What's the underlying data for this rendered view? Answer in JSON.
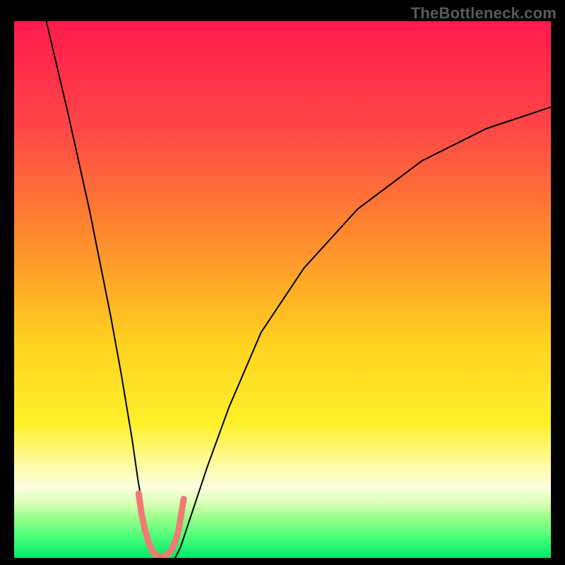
{
  "watermark": "TheBottleneck.com",
  "chart_data": {
    "type": "line",
    "title": "",
    "xlabel": "",
    "ylabel": "",
    "xlim": [
      0,
      100
    ],
    "ylim": [
      0,
      100
    ],
    "grid": false,
    "legend": null,
    "background_gradient_stops": [
      {
        "offset": 0.0,
        "color": "#ff1a4d"
      },
      {
        "offset": 0.2,
        "color": "#ff4747"
      },
      {
        "offset": 0.4,
        "color": "#ff8a2e"
      },
      {
        "offset": 0.6,
        "color": "#ffd21f"
      },
      {
        "offset": 0.75,
        "color": "#fff02a"
      },
      {
        "offset": 0.83,
        "color": "#fffca8"
      },
      {
        "offset": 0.87,
        "color": "#faffe0"
      },
      {
        "offset": 0.9,
        "color": "#d6ffb0"
      },
      {
        "offset": 0.93,
        "color": "#8fff86"
      },
      {
        "offset": 0.96,
        "color": "#4cff7a"
      },
      {
        "offset": 1.0,
        "color": "#00e66a"
      }
    ],
    "series": [
      {
        "name": "bottleneck_curve_left",
        "stroke": "#000000",
        "stroke_width": 2,
        "x": [
          6,
          10,
          14,
          18,
          20,
          22,
          23,
          24,
          25,
          26,
          27
        ],
        "y": [
          100,
          83,
          65,
          45,
          34,
          22,
          15,
          9,
          4,
          1,
          0
        ]
      },
      {
        "name": "bottleneck_curve_right",
        "stroke": "#000000",
        "stroke_width": 2,
        "x": [
          30,
          31,
          33,
          36,
          40,
          46,
          54,
          64,
          76,
          88,
          100
        ],
        "y": [
          0,
          2,
          8,
          17,
          28,
          42,
          54,
          65,
          74,
          80,
          84
        ]
      },
      {
        "name": "marker_band",
        "stroke": "#ef7b73",
        "stroke_width": 9,
        "x": [
          23.2,
          23.7,
          24.3,
          25.0,
          25.8,
          26.8,
          27.9,
          29.0,
          29.9,
          30.6,
          31.1,
          31.6
        ],
        "y": [
          12.0,
          8.5,
          5.5,
          3.0,
          1.2,
          0.2,
          0.2,
          1.0,
          2.8,
          5.0,
          8.0,
          11.0
        ]
      }
    ]
  }
}
